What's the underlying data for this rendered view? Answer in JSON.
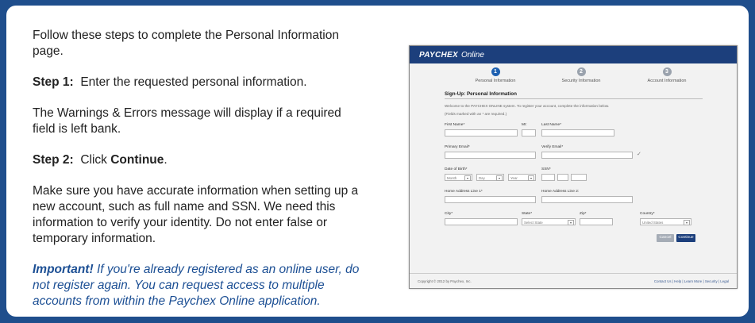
{
  "instructions": {
    "intro": "Follow these steps to complete the Personal Information page.",
    "step1_label": "Step 1:",
    "step1_text": "Enter the requested personal information.",
    "warning": "The Warnings & Errors message will display if a required field is left bank.",
    "step2_label": "Step 2:",
    "step2_text": "Click",
    "step2_bold": "Continue",
    "step2_end": ".",
    "accuracy": "Make sure you have accurate information when setting up a new account, such as full name and SSN.  We need this information to verify your identity.  Do not enter false or temporary information.",
    "important_label": "Important!",
    "important_text": "If you're already registered as an online user, do not register again. You can request access to multiple accounts from within the Paychex Online application."
  },
  "screenshot": {
    "brand": "PAYCHEX",
    "brand_suffix": "Online",
    "steps": [
      {
        "num": "1",
        "label": "Personal Information"
      },
      {
        "num": "2",
        "label": "Security Information"
      },
      {
        "num": "3",
        "label": "Account Information"
      }
    ],
    "section_title": "Sign-Up: Personal Information",
    "welcome": "Welcome to the PAYCHEX ONLINE system. To register your account, complete the information below.",
    "required_note": "(Fields marked with an * are required.)",
    "fields": {
      "first_name": "First Name*",
      "mi": "MI:",
      "last_name": "Last Name*",
      "primary_email": "Primary Email*",
      "verify_email": "Verify Email*",
      "dob": "Date of Birth*",
      "ssn": "SSN*",
      "addr1": "Home Address Line 1*",
      "addr2": "Home Address Line 2:",
      "city": "City*",
      "state": "State*",
      "zip": "Zip*",
      "country": "Country*"
    },
    "dob_month": "Month",
    "dob_day": "Day",
    "dob_year": "Year",
    "state_value": "Select State",
    "country_value": "United States",
    "cancel": "Cancel",
    "continue": "Continue",
    "copyright": "Copyright © 2012 by Paychex, Inc.",
    "footer_links": "Contact Us  |  Help  |  Learn More  |  Security  |  Legal",
    "colors": {
      "header": "#1c3f7c",
      "active_step": "#1c5fb0",
      "button": "#1c3f7c"
    }
  }
}
